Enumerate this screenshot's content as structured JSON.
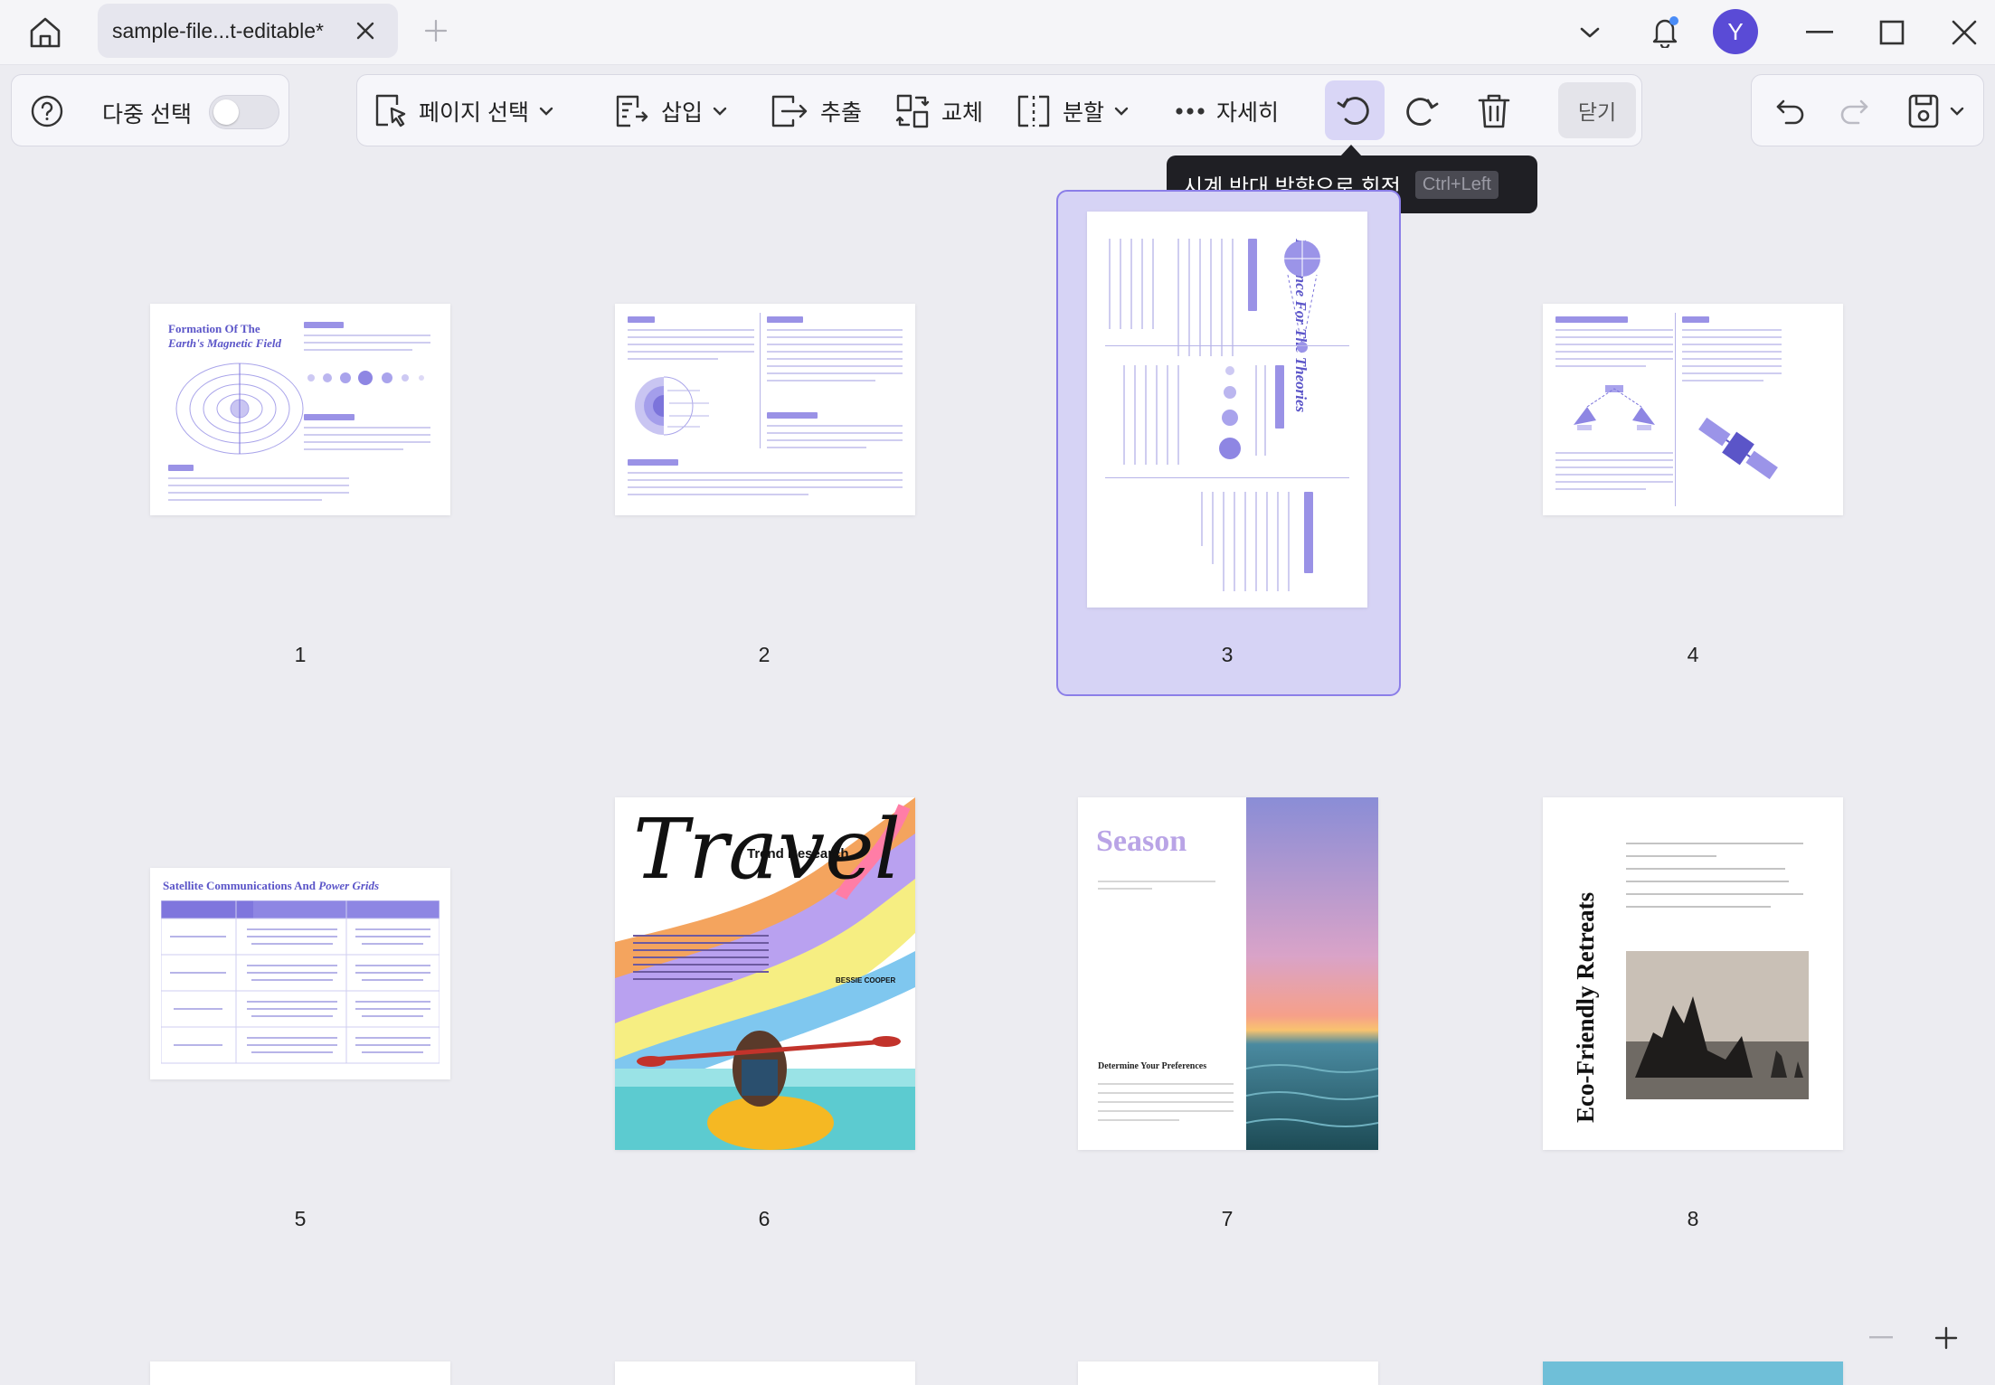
{
  "titlebar": {
    "tab_title": "sample-file...t-editable*",
    "avatar_initial": "Y"
  },
  "toolbar": {
    "multi_select_label": "다중 선택",
    "multi_select_on": false,
    "page_select_label": "페이지 선택",
    "insert_label": "삽입",
    "extract_label": "추출",
    "replace_label": "교체",
    "split_label": "분할",
    "more_label": "자세히",
    "close_label": "닫기"
  },
  "tooltip": {
    "text": "시계 반대 방향으로 회전",
    "shortcut": "Ctrl+Left"
  },
  "pages": [
    {
      "number": "1",
      "title_line1": "Formation Of The",
      "title_line2": "Earth's Magnetic Field"
    },
    {
      "number": "2"
    },
    {
      "number": "3",
      "title": "Evidence For The Theories",
      "selected": true
    },
    {
      "number": "4"
    },
    {
      "number": "5",
      "title_plain": "Satellite Communications And",
      "title_italic": "Power Grids"
    },
    {
      "number": "6",
      "title": "Travel",
      "subtitle": "Trend Research",
      "author": "BESSIE COOPER"
    },
    {
      "number": "7",
      "title": "Season",
      "subtitle": "Determine Your Preferences"
    },
    {
      "number": "8",
      "title": "Eco-Friendly Retreats"
    }
  ],
  "colors": {
    "accent": "#5b4bd6",
    "selected_bg": "#d6d3f5",
    "selected_border": "#8b7ee8",
    "tooltip_bg": "#1f1f24"
  }
}
